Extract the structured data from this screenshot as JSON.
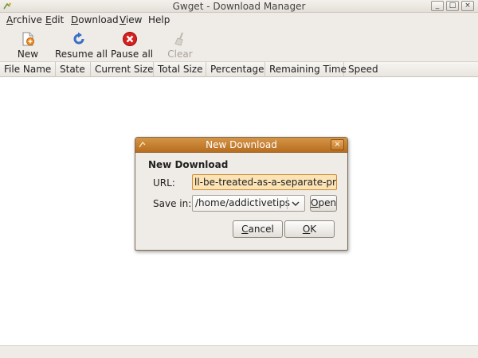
{
  "window": {
    "title": "Gwget - Download Manager",
    "controls": {
      "minimize": "_",
      "maximize": "□",
      "close": "×"
    }
  },
  "menubar": {
    "items": [
      {
        "label": "Archive",
        "mnemonic": "A",
        "rest": "rchive"
      },
      {
        "label": "Edit",
        "mnemonic": "E",
        "rest": "dit"
      },
      {
        "label": "Download",
        "mnemonic": "D",
        "rest": "ownload"
      },
      {
        "label": "View",
        "mnemonic": "V",
        "rest": "iew"
      },
      {
        "label": "Help",
        "mnemonic": "",
        "rest": "Help"
      }
    ]
  },
  "toolbar": {
    "new_label": "New",
    "resume_label": "Resume all",
    "pause_label": "Pause all",
    "clear_label": "Clear",
    "icons": {
      "new": "new-download-icon",
      "resume": "resume-icon",
      "pause": "stop-icon",
      "clear": "clear-broom-icon"
    }
  },
  "columns": [
    "File Name",
    "State",
    "Current Size",
    "Total Size",
    "Percentage",
    "Remaining Time",
    "Speed"
  ],
  "dialog": {
    "title": "New Download",
    "heading": "New Download",
    "url_label": "URL:",
    "url_value": "ll-be-treated-as-a-separate-process/",
    "save_label": "Save in:",
    "save_value": "/home/addictivetips",
    "open_button": {
      "mnemonic": "O",
      "rest": "pen"
    },
    "cancel_button": {
      "mnemonic": "C",
      "rest": "ancel"
    },
    "ok_button": {
      "mnemonic": "O",
      "rest": "K"
    },
    "close": "×"
  },
  "colors": {
    "dialog_title_top": "#d49548",
    "dialog_title_bottom": "#b86d1f",
    "url_field_bg": "#fbe3b5",
    "pause_icon": "#d61f1f",
    "resume_icon": "#3a6fc4"
  }
}
